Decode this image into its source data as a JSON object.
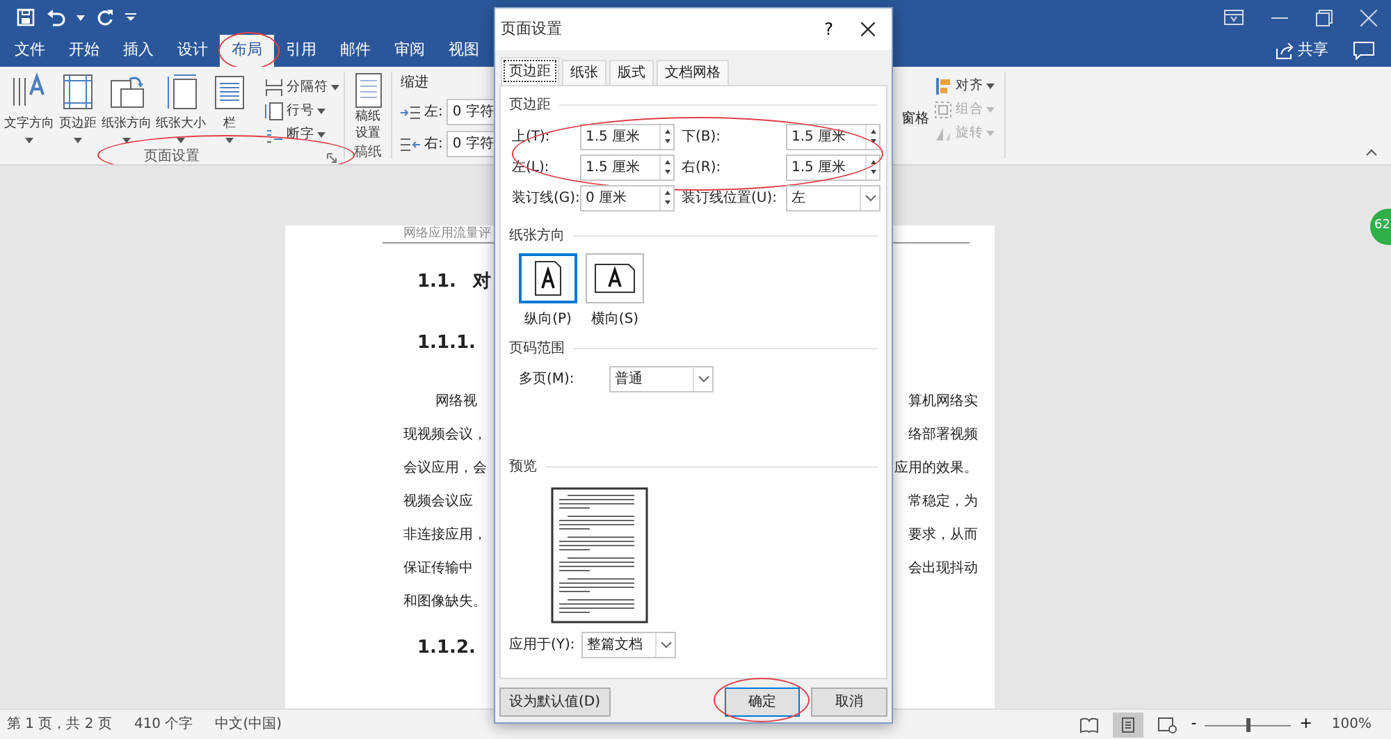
{
  "tabs": [
    {
      "label": "文件",
      "selected": false,
      "highlighted": false
    },
    {
      "label": "开始",
      "selected": false,
      "highlighted": false
    },
    {
      "label": "插入",
      "selected": false,
      "highlighted": false
    },
    {
      "label": "设计",
      "selected": false,
      "highlighted": false
    },
    {
      "label": "布局",
      "selected": true,
      "highlighted": true
    },
    {
      "label": "引用",
      "selected": false,
      "highlighted": false
    },
    {
      "label": "邮件",
      "selected": false,
      "highlighted": false
    },
    {
      "label": "审阅",
      "selected": false,
      "highlighted": false
    },
    {
      "label": "视图",
      "selected": false,
      "highlighted": false
    }
  ],
  "share": {
    "label": "共享"
  },
  "ribbon": {
    "page_setup": {
      "label": "页面设置",
      "highlighted": true,
      "large_buttons": [
        {
          "kind": "text_direction",
          "label": "文字方向"
        },
        {
          "kind": "margins",
          "label": "页边距"
        },
        {
          "kind": "orientation",
          "label": "纸张方向"
        },
        {
          "kind": "size",
          "label": "纸张大小"
        },
        {
          "kind": "columns",
          "label": "栏"
        }
      ],
      "small_buttons": [
        {
          "kind": "breaks",
          "label": "分隔符"
        },
        {
          "kind": "line_numbers",
          "label": "行号"
        },
        {
          "kind": "hyphenation",
          "label": "断字"
        }
      ]
    },
    "manuscript": {
      "label": "稿纸",
      "button_lines": [
        "稿纸",
        "设置"
      ]
    },
    "paragraph": {
      "indent_label": "缩进",
      "fields": [
        {
          "kind": "left",
          "label": "左:",
          "value": "0 字符"
        },
        {
          "kind": "right",
          "label": "右:",
          "value": "0 字符"
        }
      ]
    },
    "arrange": {
      "partial_label": "窗格",
      "small_buttons": [
        {
          "kind": "align",
          "label": "对齐",
          "disabled": false
        },
        {
          "kind": "group",
          "label": "组合",
          "disabled": true
        },
        {
          "kind": "rotate",
          "label": "旋转",
          "disabled": true
        }
      ]
    }
  },
  "document": {
    "header_text": "网络应用流量评",
    "blocks": [
      {
        "kind": "heading",
        "number": "1.1.",
        "title": "对"
      },
      {
        "kind": "heading",
        "number": "1.1.1."
      },
      {
        "kind": "first_line",
        "left": "网络视",
        "right": "算机网络实"
      },
      {
        "kind": "line",
        "left": "现视频会议，",
        "right": "络部署视频"
      },
      {
        "kind": "line",
        "left": "会议应用，会",
        "right": "应用的效果。"
      },
      {
        "kind": "line",
        "left": "视频会议应",
        "right": "常稳定，为"
      },
      {
        "kind": "line",
        "left": "非连接应用，",
        "right": "要求，从而"
      },
      {
        "kind": "line",
        "left": "保证传输中",
        "right": "会出现抖动"
      },
      {
        "kind": "line",
        "left": "和图像缺失。"
      },
      {
        "kind": "heading",
        "number": "1.1.2."
      }
    ]
  },
  "side_badge": "62",
  "dialog": {
    "title": "页面设置",
    "help": "?",
    "tabs": [
      {
        "label": "页边距",
        "selected": true
      },
      {
        "label": "纸张",
        "selected": false
      },
      {
        "label": "版式",
        "selected": false
      },
      {
        "label": "文档网格",
        "selected": false
      }
    ],
    "margins": {
      "heading": "页边距",
      "highlighted": true,
      "fields": [
        {
          "label": "上(T):",
          "value": "1.5 厘米"
        },
        {
          "label": "下(B):",
          "value": "1.5 厘米"
        },
        {
          "label": "左(L):",
          "value": "1.5 厘米"
        },
        {
          "label": "右(R):",
          "value": "1.5 厘米"
        }
      ]
    },
    "gutter": {
      "label": "装订线(G):",
      "value": "0 厘米"
    },
    "gutter_position": {
      "label": "装订线位置(U):",
      "value": "左"
    },
    "orientation": {
      "heading": "纸张方向",
      "options": [
        {
          "kind": "portrait",
          "label": "纵向(P)",
          "selected": true
        },
        {
          "kind": "landscape",
          "label": "横向(S)",
          "selected": false
        }
      ]
    },
    "pages": {
      "heading": "页码范围",
      "label": "多页(M):",
      "value": "普通"
    },
    "preview": {
      "heading": "预览",
      "apply_label": "应用于(Y):",
      "apply_value": "整篇文档"
    },
    "buttons": [
      {
        "kind": "default",
        "label": "设为默认值(D)",
        "highlighted": false
      },
      {
        "kind": "ok",
        "label": "确定",
        "highlighted": true
      },
      {
        "kind": "cancel",
        "label": "取消",
        "highlighted": false
      }
    ]
  },
  "status_bar": {
    "page": "第 1 页，共 2 页",
    "words": "410 个字",
    "language": "中文(中国)",
    "views": [
      {
        "kind": "read",
        "selected": false
      },
      {
        "kind": "print",
        "selected": true
      },
      {
        "kind": "web",
        "selected": false
      }
    ],
    "zoom": {
      "minus": "-",
      "plus": "+",
      "level": 0.5,
      "reading": "100%"
    }
  }
}
